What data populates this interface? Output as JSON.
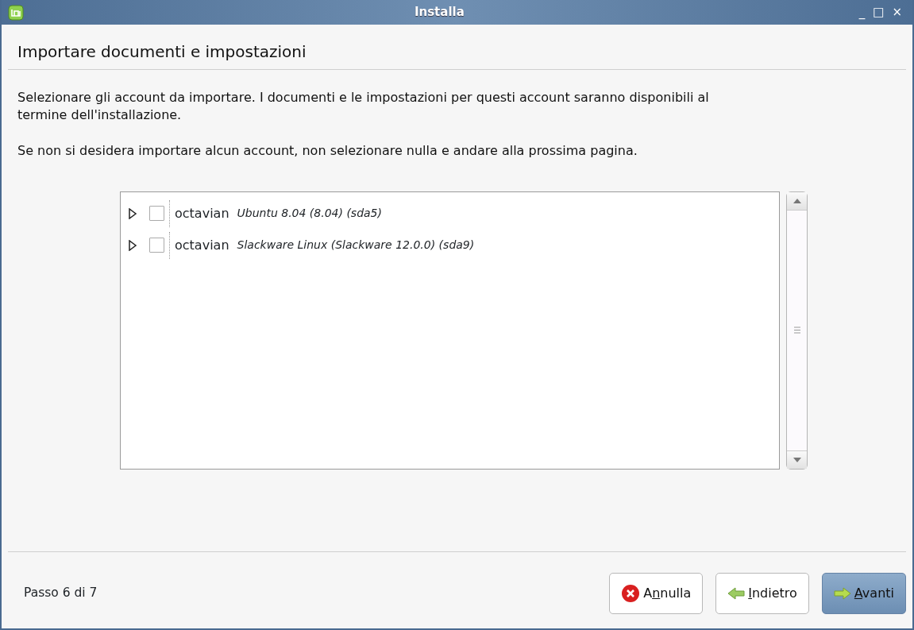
{
  "window": {
    "title": "Installa",
    "controls": [
      "_",
      "□",
      "×"
    ]
  },
  "heading": "Importare documenti e impostazioni",
  "paragraphs": [
    "Selezionare gli account da importare. I documenti e le impostazioni per questi account saranno disponibili al termine dell'installazione.",
    "Se non si desidera importare alcun account, non selezionare nulla e andare alla prossima pagina."
  ],
  "accounts": [
    {
      "name": "octavian",
      "description": "Ubuntu 8.04 (8.04) (sda5)",
      "checked": false,
      "expanded": false
    },
    {
      "name": "octavian",
      "description": "Slackware Linux (Slackware 12.0.0) (sda9)",
      "checked": false,
      "expanded": false
    }
  ],
  "step": "Passo 6 di 7",
  "buttons": [
    {
      "kind": "cancel",
      "before": "A",
      "mnemonic": "n",
      "after": "nulla",
      "default": false
    },
    {
      "kind": "back",
      "mnemonic": "I",
      "after": "ndietro",
      "default": false
    },
    {
      "kind": "forward",
      "mnemonic": "A",
      "after": "vanti",
      "default": true
    }
  ]
}
